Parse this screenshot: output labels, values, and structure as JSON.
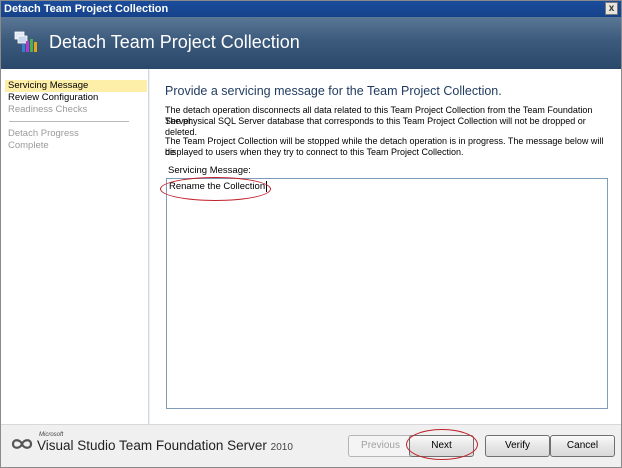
{
  "window": {
    "title": "Detach Team Project Collection",
    "close_glyph": "x"
  },
  "banner": {
    "heading": "Detach Team Project Collection",
    "icon": "collection-icon"
  },
  "sidebar": {
    "items": [
      {
        "label": "Servicing Message",
        "state": "active"
      },
      {
        "label": "Review Configuration",
        "state": "enabled"
      },
      {
        "label": "Readiness Checks",
        "state": "disabled"
      },
      {
        "label": "Detach Progress",
        "state": "disabled"
      },
      {
        "label": "Complete",
        "state": "disabled"
      }
    ]
  },
  "content": {
    "subtitle": "Provide a servicing message for the Team Project Collection.",
    "para1_line1": "The detach operation disconnects all data related to this Team Project Collection from the Team Foundation Server.",
    "para1_line2": "The physical SQL Server database that corresponds to this Team Project Collection will not be dropped or deleted.",
    "para2_line1": "The Team Project Collection will be stopped while the detach operation is in progress. The message below will be",
    "para2_line2": "displayed to users when they try to connect to this Team Project Collection.",
    "message_label": "Servicing Message:",
    "message_value": "Rename the Collection"
  },
  "footer": {
    "brand_microsoft": "Microsoft",
    "brand_main": "Visual Studio Team Foundation Server",
    "brand_year": "2010",
    "buttons": {
      "previous": "Previous",
      "next": "Next",
      "verify": "Verify",
      "cancel": "Cancel"
    }
  },
  "colors": {
    "highlight_oval": "#c0202a",
    "active_nav": "#fdeea8",
    "titlebar": "#1b4d9c"
  }
}
